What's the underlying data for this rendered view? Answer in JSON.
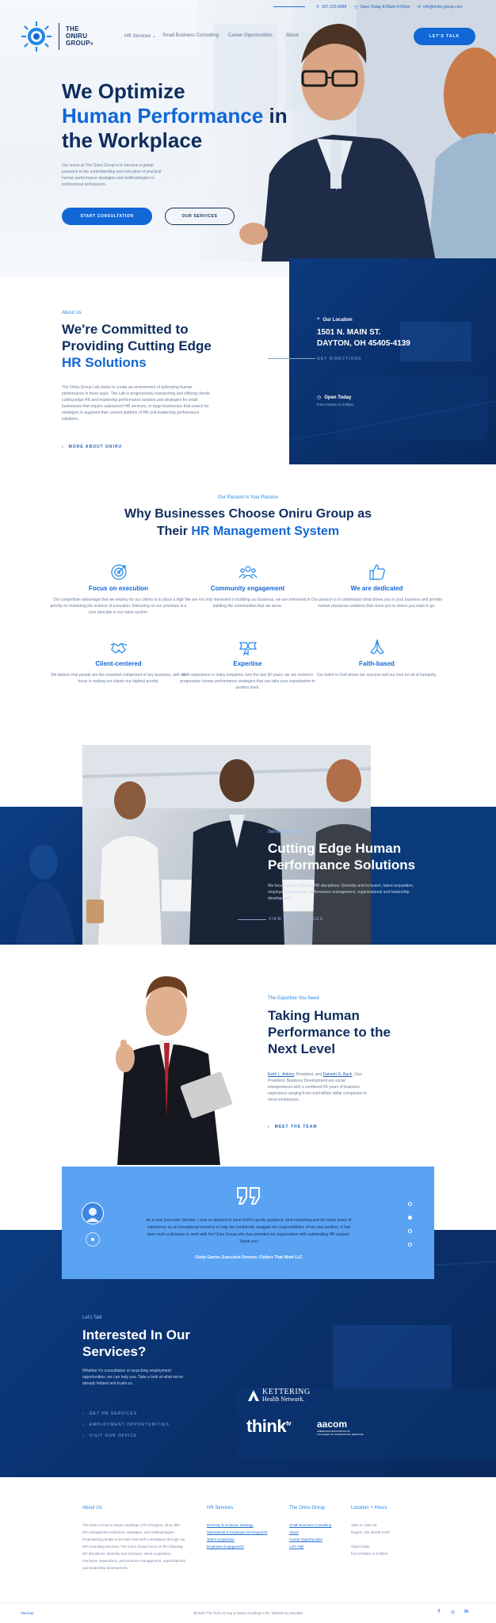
{
  "topbar": {
    "phone": "937-223-9989",
    "hours": "Open Today 8:00am-5:00pm",
    "email": "info@oniru group.com"
  },
  "header": {
    "logo_line1": "THE",
    "logo_line2": "ONIRU",
    "logo_line3": "GROUP",
    "nav": [
      "HR Services",
      "Small Business Consulting",
      "Career Opportunities",
      "About"
    ],
    "cta": "LET'S TALK"
  },
  "hero": {
    "title_line1": "We Optimize",
    "title_highlight": "Human Performance",
    "title_in": " in",
    "title_line3": "the Workplace",
    "paragraph": "Our vision at The Oniru Group is to become a global presence in the understanding and execution of practical human performance strategies and methodologies in professional workspaces.",
    "btn_primary": "START CONSULTATION",
    "btn_secondary": "OUR SERVICES"
  },
  "about": {
    "eyebrow": "About Us",
    "title_line1": "We're Committed to",
    "title_line2": "Providing Cutting Edge",
    "title_highlight": "HR Solutions",
    "paragraph": "The Oniru Group Lab seeks to create an environment of optimizing human performance in three ways. The Lab is progressively researching and offering clients cutting-edge HR and leadership performance solution and strategies for small businesses that require outsourced HR services, or large businesses that search for strategies to augment their current platform of HR and leadership performance initiatives.",
    "more": "MORE ABOUT ONIRU",
    "location_label": "Our Location",
    "address_line1": "1501 N. MAIN ST.",
    "address_line2": "DAYTON, OH 45405-4139",
    "directions": "GET DIRECTIONS",
    "open_label": "Open Today",
    "open_hours": "from 8:00am to 5:00pm"
  },
  "why": {
    "eyebrow": "Our Passion Is Your Passion",
    "title_line1": "Why Businesses Choose Oniru Group as",
    "title_their": "Their ",
    "title_highlight": "HR Management System",
    "features": [
      {
        "icon": "target-icon",
        "title": "Focus on execution",
        "desc": "Our competitive advantage that we employ for our clients is to place a high priority on mastering the science of execution. Delivering on our promises is a core principle in our value system."
      },
      {
        "icon": "community-icon",
        "title": "Community engagement",
        "desc": "We are not only interested in building our business, we are interested in building the communities that we serve."
      },
      {
        "icon": "thumbs-up-icon",
        "title": "We are dedicated",
        "desc": "Our passion is to understand what drives you in your business and provide human resources solutions that move you to where you want to go."
      },
      {
        "icon": "handshake-icon",
        "title": "Client-centered",
        "desc": "We believe that people are the essential component of any business, and our focus is making our clients our highest priority."
      },
      {
        "icon": "ribbon-icon",
        "title": "Expertise",
        "desc": "With experience in many industries over the last 30 years, we are rooted in progressive human performance strategies that can take your organization to another level."
      },
      {
        "icon": "faith-icon",
        "title": "Faith-based",
        "desc": "Our belief in God drives our success and our love for all of humanity."
      }
    ]
  },
  "services": {
    "eyebrow": "Service We Offer",
    "title_line1": "Cutting Edge Human",
    "title_line2": "Performance Solutions",
    "paragraph": "We focus on the following HR disciplines: Diversity and Inclusion, talent acquisition, employee separations, performance management, organizational and leadership development.",
    "link": "VIEW OUR SERVICES"
  },
  "team": {
    "eyebrow": "The Expertise You Need",
    "title_line1": "Taking Human",
    "title_line2": "Performance to the",
    "title_line3": "Next Level",
    "name1": "Keith L. Ankins",
    "role1": ", President, and ",
    "name2": "Dametri G. Bach",
    "paragraph": ", Vice President, Business Development are social entrepreneurs with a combined 55 years of business experience ranging from multi-billion dollar companies to micro-enterprises.",
    "link": "MEET THE TEAM"
  },
  "testimonial": {
    "quote": "As a new Executive Director, I was so pleased to have Keith's gentle guidance, kind mentoring and his many years of experience as an exceptional resource to help me confidently navigate the responsibilities of my new position. It has been such a pleasure to work with the Oniru Group who has provided our organization with outstanding HR support. Thank you!",
    "author": "Cindy Garner, Executive Director, Clothes That Work LLC"
  },
  "cta": {
    "eyebrow": "Let's Talk",
    "title_line1": "Interested In Our",
    "title_line2": "Services?",
    "paragraph": "Whether it's consultation or searching employment opportunities, we can help you. Take a look at what we've already helped and trusts us.",
    "links": [
      "GET HR SERVICES",
      "EMPLOYMENT OPPORTUNITIES",
      "VISIT OUR OFFICE"
    ],
    "partner1_line1": "KETTERING",
    "partner1_line2": "Health Network.",
    "partner2": "think",
    "partner2_sup": "tv",
    "partner3": "aacom",
    "partner3_sub1": "AMERICAN ASSOCIATION OF",
    "partner3_sub2": "COLLEGES OF OSTEOPATHIC MEDICINE"
  },
  "footer": {
    "about_title": "About Us",
    "about_text": "The Oniru Group is Deans Holdings LTD of Dayton, Ohio offer HR management solutions, strategies, and methodologies. Empowering people to be their best self in workplace through our HR consulting services. The Oniru Group focus on the following HR disciplines: diversity and inclusion, talent acquisition, employee separations, performance management, organizational and leadership development.",
    "hr_title": "HR Services",
    "hr_links": [
      "Diversity & Inclusion Strategy",
      "Operational & Employee Development",
      "Talent Acquisition",
      "Employee Engagement"
    ],
    "group_title": "The Oniru Group",
    "group_links": [
      "Small Business Consulting",
      "About",
      "Career Opportunities",
      "Let's Talk"
    ],
    "loc_title": "Location + Hours",
    "loc_lines": [
      "1501 N. Main St.",
      "Dayton, OH 45405-4139",
      "",
      "Open today",
      "from 8:00am to 5:00pm"
    ],
    "sitemap": "Sitemap",
    "copyright": "@2020 The Oniru Group & Deans Holdings LTD. Website by Nexalite"
  },
  "colors": {
    "primary": "#1167d6",
    "navy": "#0f2d5e",
    "band": "#0a3a7a",
    "testimonial": "#5aa3f2"
  }
}
